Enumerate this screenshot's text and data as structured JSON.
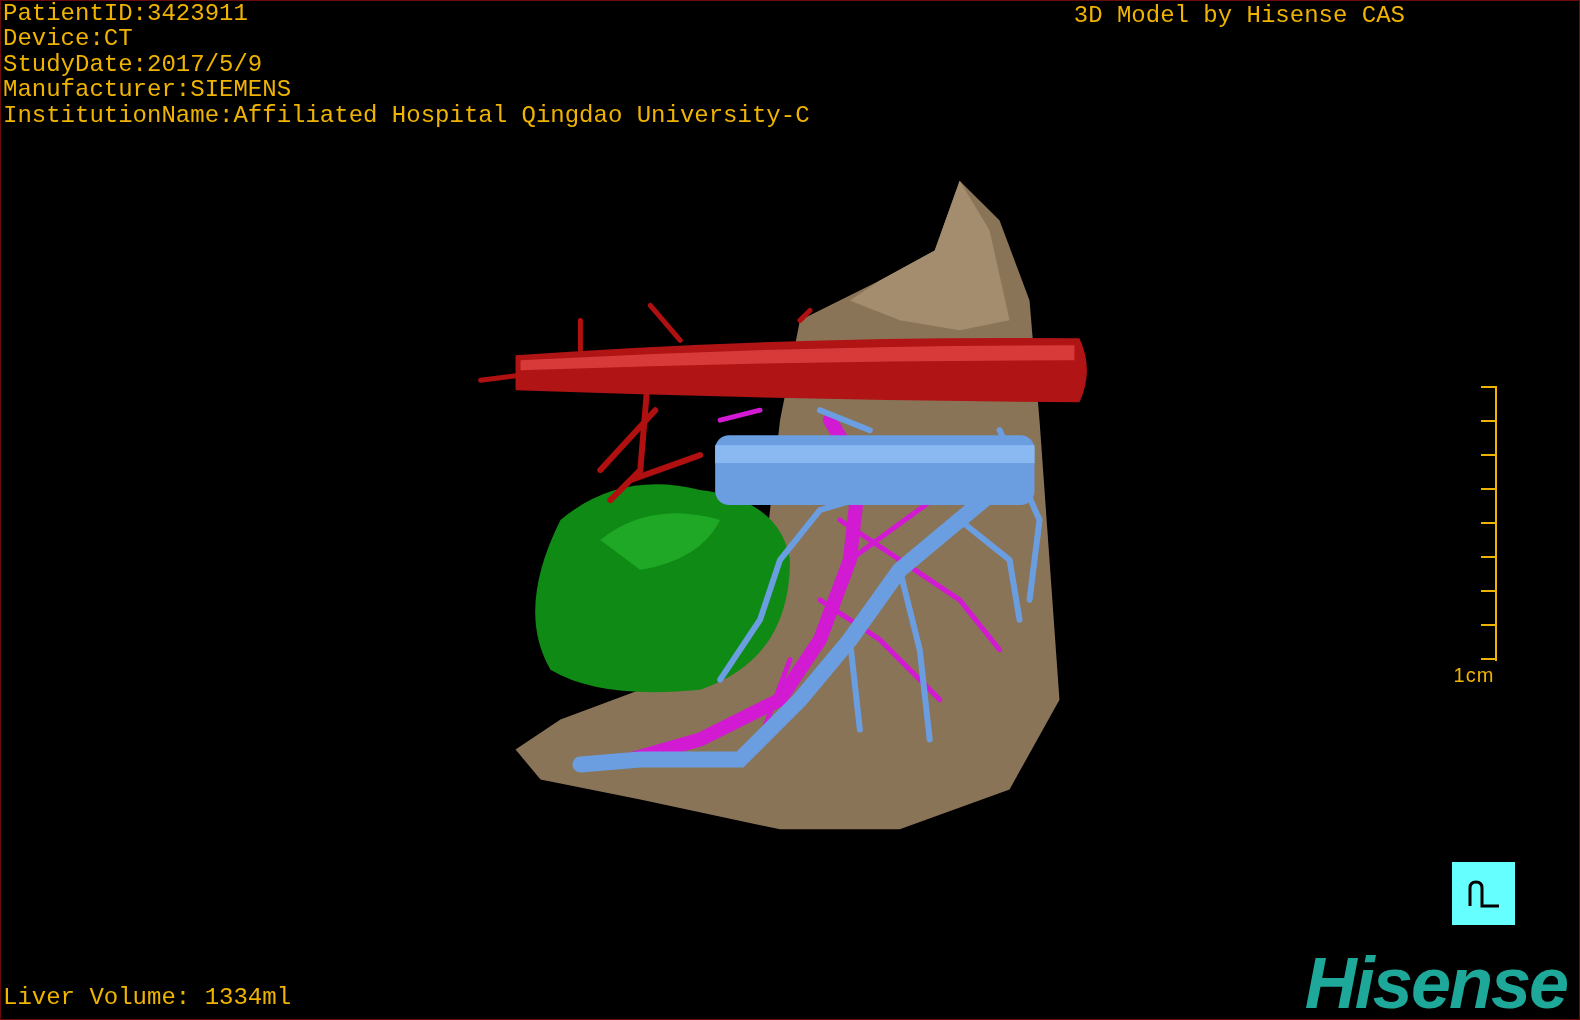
{
  "patient_info": [
    "PatientID:3423911",
    "Device:CT",
    "StudyDate:2017/5/9",
    "Manufacturer:SIEMENS",
    "InstitutionName:Affiliated Hospital Qingdao University-C"
  ],
  "header_title": "3D Model by Hisense CAS",
  "scale_bar": {
    "label": "1cm"
  },
  "liver_volume": "Liver Volume: 1334ml",
  "logo": "Hisense"
}
